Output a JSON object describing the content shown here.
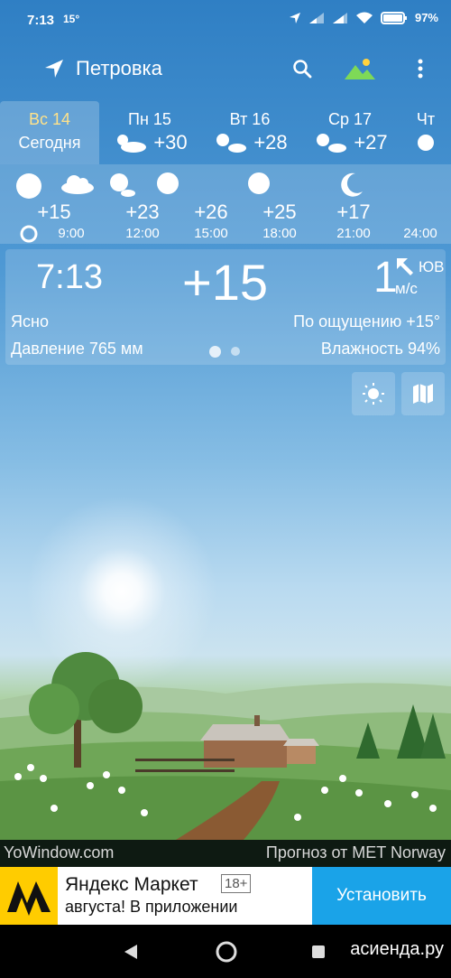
{
  "status": {
    "time": "7:13",
    "temp": "15°",
    "battery": "97%",
    "icons": [
      "location-arrow-icon",
      "signal-icon",
      "signal-icon",
      "wifi-icon",
      "battery-icon"
    ]
  },
  "header": {
    "location": "Петровка",
    "icons": [
      "location-arrow-icon",
      "search-icon",
      "landscape-icon",
      "more-vert-icon"
    ]
  },
  "days": [
    {
      "name": "Вс 14",
      "sub": "Сегодня"
    },
    {
      "name": "Пн 15",
      "temp": "+30",
      "icon": "sun-cloud-icon"
    },
    {
      "name": "Вт 16",
      "temp": "+28",
      "icon": "sun-cloud-icon"
    },
    {
      "name": "Ср 17",
      "temp": "+27",
      "icon": "sun-cloud-icon"
    },
    {
      "name": "Чт",
      "icon": "sun-icon"
    }
  ],
  "hourly": [
    {
      "temp": "+15",
      "hour": "9:00",
      "icon": "sun-icon"
    },
    {
      "temp": "+23",
      "hour": "12:00",
      "icon": "cloud-icon"
    },
    {
      "temp": "+26",
      "hour": "15:00",
      "icon": "sun-icon"
    },
    {
      "temp": "+25",
      "hour": "18:00",
      "icon": "sun-icon"
    },
    {
      "temp": "+17",
      "hour": "21:00",
      "icon": "moon-icon"
    },
    {
      "temp": "",
      "hour": "24:00",
      "icon": ""
    }
  ],
  "now": {
    "time": "7:13",
    "temp": "+15",
    "wind_speed": "1",
    "wind_unit": "м/с",
    "wind_dir": "ЮВ",
    "condition": "Ясно",
    "feels_like": "По ощущению +15°",
    "pressure": "Давление 765 мм",
    "humidity": "Влажность 94%"
  },
  "buttons": {
    "icons": [
      "sun-forecast-icon",
      "map-icon"
    ]
  },
  "footer": {
    "left": "YoWindow.com",
    "right": "Прогноз от MET Norway"
  },
  "ad": {
    "title": "Яндекс Маркет",
    "badge": "18+",
    "line2": "августа! В приложении",
    "cta": "Установить"
  },
  "navbar": {
    "watermark": "асиенда.ру"
  },
  "colors": {
    "sky_top": "#2f7fc4",
    "sky_low": "#b9daf0",
    "active_day": "#ffe28a",
    "ad_button": "#1aa3e8",
    "ad_logo": "#ffcc00"
  }
}
